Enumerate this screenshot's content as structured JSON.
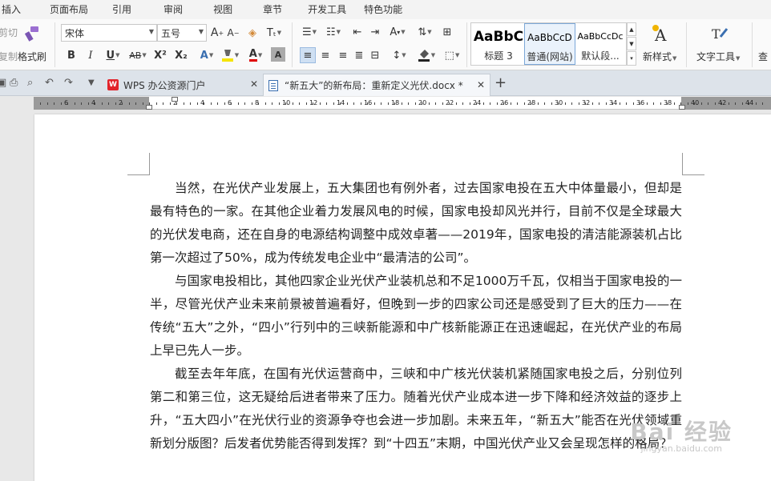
{
  "menu": [
    "插入",
    "页面布局",
    "引用",
    "审阅",
    "视图",
    "章节",
    "开发工具",
    "特色功能"
  ],
  "ribbon": {
    "cut_label": "剪切",
    "copy_label": "复制",
    "format_painter_label": "格式刷",
    "font_name": "宋体",
    "font_size": "五号",
    "bold": "B",
    "italic": "I",
    "underline": "U",
    "strikethrough": "AB",
    "superscript": "X²",
    "subscript": "X₂",
    "styles": [
      {
        "sample": "AaBbC",
        "name": "标题 3"
      },
      {
        "sample": "AaBbCcD",
        "name": "普通(网站)"
      },
      {
        "sample": "AaBbCcDc",
        "name": "默认段..."
      }
    ],
    "new_style_label": "新样式",
    "text_tools_label": "文字工具",
    "find_label": "查"
  },
  "tabs": [
    {
      "title": "WPS 办公资源门户",
      "logo": "W"
    },
    {
      "title": "“新五大”的新布局：重新定义光伏.docx *"
    }
  ],
  "ruler": {
    "labels": [
      "6",
      "4",
      "2",
      "2",
      "4",
      "6",
      "8",
      "10",
      "12",
      "14",
      "16",
      "18",
      "20",
      "22",
      "24",
      "26",
      "28",
      "30",
      "32",
      "34",
      "36",
      "38",
      "40",
      "42",
      "44",
      "46"
    ]
  },
  "document": {
    "paragraphs": [
      "当然，在光伏产业发展上，五大集团也有例外者，过去国家电投在五大中体量最小，但却是最有特色的一家。在其他企业着力发展风电的时候，国家电投却风光并行，目前不仅是全球最大的光伏发电商，还在自身的电源结构调整中成效卓著——2019年，国家电投的清洁能源装机占比第一次超过了50%，成为传统发电企业中“最清洁的公司”。",
      "与国家电投相比，其他四家企业光伏产业装机总和不足1000万千瓦，仅相当于国家电投的一半，尽管光伏产业未来前景被普遍看好，但晚到一步的四家公司还是感受到了巨大的压力——在传统“五大”之外，“四小”行列中的三峡新能源和中广核新能源正在迅速崛起，在光伏产业的布局上早已先人一步。",
      "截至去年年底，在国有光伏运营商中，三峡和中广核光伏装机紧随国家电投之后，分别位列第二和第三位，这无疑给后进者带来了压力。随着光伏产业成本进一步下降和经济效益的逐步上升，“五大四小”在光伏行业的资源争夺也会进一步加剧。未来五年，“新五大”能否在光伏领域重新划分版图？后发者优势能否得到发挥？到“十四五”末期，中国光伏产业又会呈现怎样的格局？"
    ]
  },
  "watermark": {
    "top": "Bai 经验",
    "bottom": "jingyan.baidu.com"
  }
}
